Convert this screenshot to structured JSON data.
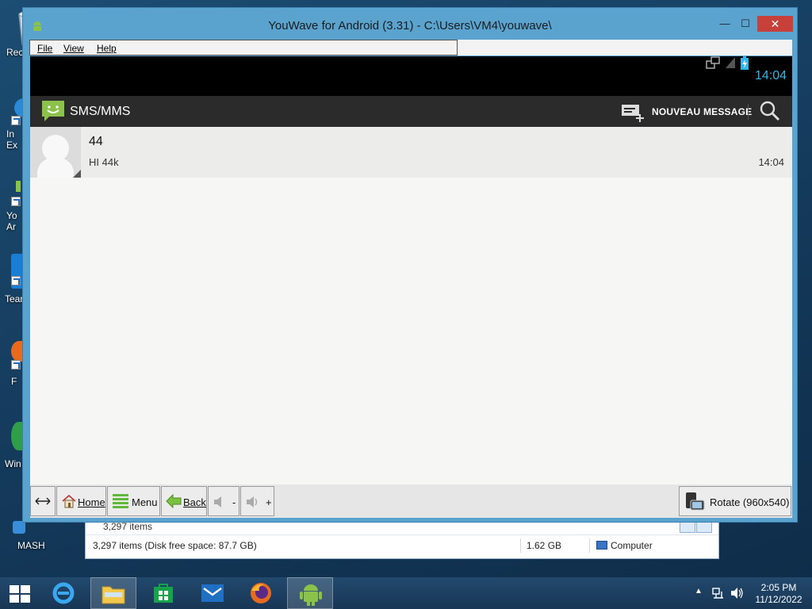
{
  "desktop": {
    "icons": [
      {
        "label": "Rec"
      },
      {
        "label": "In\nEx"
      },
      {
        "label": "Yo\nAr"
      },
      {
        "label": "Tean"
      },
      {
        "label": "F"
      },
      {
        "label": "Win"
      },
      {
        "label": "MASH"
      }
    ]
  },
  "explorer": {
    "items_top": "3,297 items",
    "status_items": "3,297 items (Disk free space: 87.7 GB)",
    "status_size": "1.62 GB",
    "status_location": "Computer"
  },
  "youwave": {
    "title": "YouWave for Android (3.31) - C:\\Users\\VM4\\youwave\\",
    "menu": [
      "File",
      "View",
      "Help"
    ],
    "android": {
      "status_time": "14:04",
      "app_title": "SMS/MMS",
      "new_message_label": "NOUVEAU MESSAGE",
      "conversations": [
        {
          "name": "44",
          "snippet": "HI 44k",
          "time": "14:04"
        }
      ]
    },
    "toolbar": {
      "home": "Home",
      "menu": "Menu",
      "back": "Back",
      "vol_down": "-",
      "vol_up": "+",
      "rotate": "Rotate (960x540)"
    }
  },
  "taskbar": {
    "clock_time": "2:05 PM",
    "clock_date": "11/12/2022"
  },
  "colors": {
    "window_frame": "#5aa3cf",
    "android_accent": "#33b5e5",
    "close_button": "#c7413a",
    "sms_green": "#8bc34a"
  }
}
